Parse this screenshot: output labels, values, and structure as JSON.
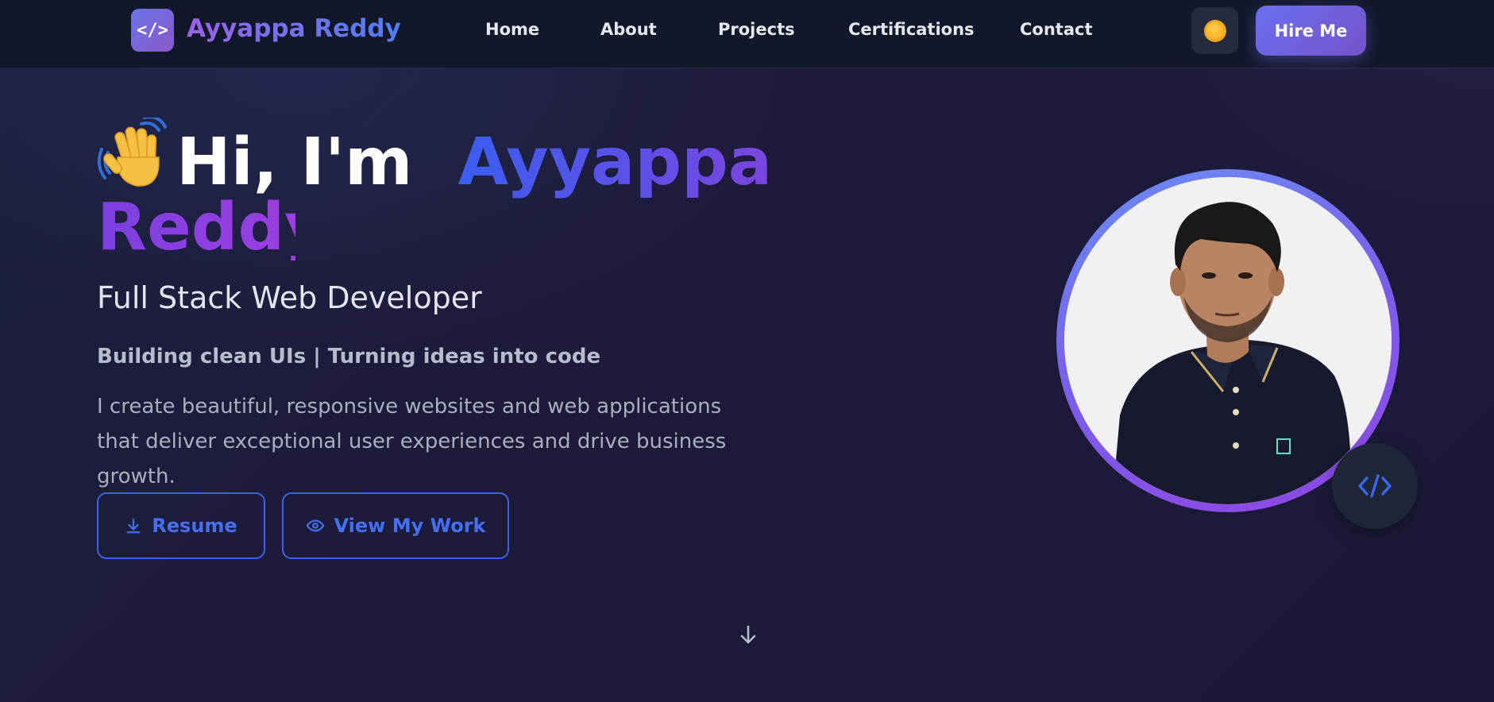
{
  "brand": {
    "logo_glyph": "</>",
    "name": "Ayyappa Reddy"
  },
  "nav": {
    "links": [
      "Home",
      "About",
      "Projects",
      "Certifications",
      "Contact"
    ],
    "theme_toggle_icon": "sun-icon",
    "hire_label": "Hire Me"
  },
  "hero": {
    "greeting_emoji": "waving-hand-icon",
    "greeting": "Hi, I'm",
    "first_name": "Ayyappa",
    "last_name": "Reddy",
    "role": "Full Stack Web Developer",
    "tagline": "Building clean UIs | Turning ideas into code",
    "description": "I create beautiful, responsive websites and web applications that deliver exceptional user experiences and drive business growth.",
    "buttons": {
      "resume_label": "Resume",
      "resume_icon": "download-icon",
      "work_label": "View My Work",
      "work_icon": "eye-icon"
    },
    "scroll_icon": "arrow-down-icon"
  },
  "profile": {
    "photo": "profile-photo",
    "badge_icon": "code-icon",
    "badge_glyph": "</>"
  },
  "colors": {
    "accent_blue": "#3d62e8",
    "accent_purple": "#7a45e0",
    "nav_bg": "#121829",
    "page_bg": "#1b1b38"
  }
}
